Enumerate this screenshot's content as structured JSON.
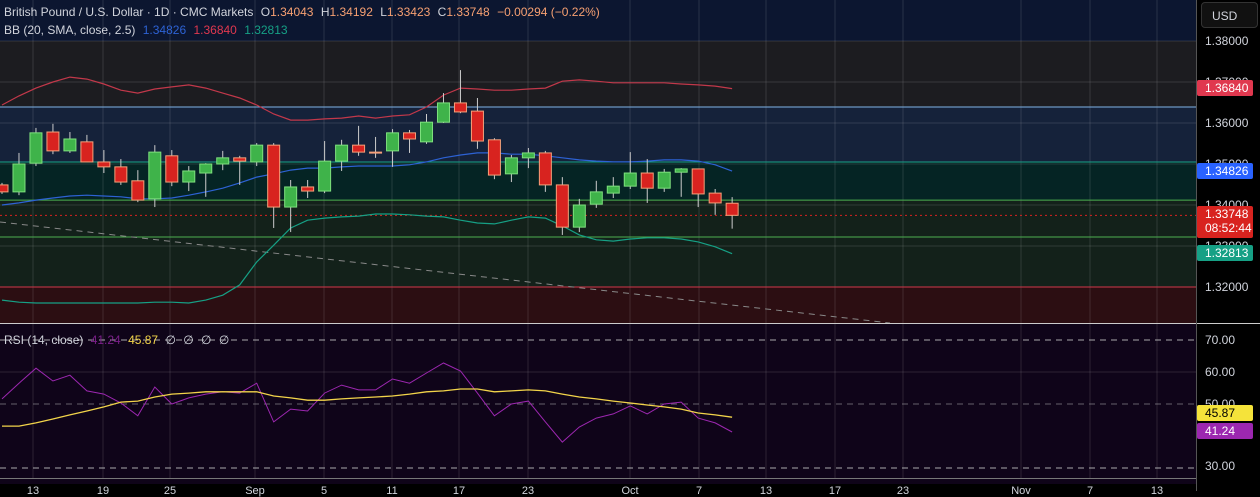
{
  "header": {
    "symbol": "British Pound / U.S. Dollar · 1D · CMC Markets",
    "open_label": "O",
    "open": "1.34043",
    "high_label": "H",
    "high": "1.34192",
    "low_label": "L",
    "low": "1.33423",
    "close_label": "C",
    "close": "1.33748",
    "change": "−0.00294 (−0.22%)"
  },
  "bb_legend": {
    "label": "BB (20, SMA, close, 2.5)",
    "basis": "1.34826",
    "upper": "1.36840",
    "lower": "1.32813"
  },
  "rsi_legend": {
    "label": "RSI (14, close)",
    "rsi": "41.24",
    "ma": "45.87",
    "na1": "∅",
    "na2": "∅",
    "na3": "∅",
    "na4": "∅"
  },
  "axis": {
    "currency": "USD",
    "price_ticks": [
      "1.38000",
      "1.37000",
      "1.36000",
      "1.35000",
      "1.34000",
      "1.33000",
      "1.32000"
    ],
    "rsi_ticks": [
      "70.00",
      "60.00",
      "50.00",
      "30.00"
    ],
    "badges": {
      "upper": "1.36840",
      "basis": "1.34826",
      "price": "1.33748",
      "countdown": "08:52:44",
      "lower": "1.32813",
      "ma": "45.87",
      "rsi": "41.24"
    }
  },
  "x_labels": [
    "13",
    "19",
    "25",
    "Sep",
    "5",
    "11",
    "17",
    "23",
    "Oct",
    "7",
    "13",
    "17",
    "23",
    "Nov",
    "7",
    "13"
  ],
  "colors": {
    "up": "#3fb34a",
    "down": "#d8231f",
    "upper_band": "#c2384a",
    "basis": "#2d62d4",
    "lower_band": "#16a085",
    "rsi": "#9c27b0",
    "rsi_ma": "#f2d44a"
  },
  "chart_data": {
    "type": "candlestick",
    "title": "British Pound / U.S. Dollar · 1D · CMC Markets",
    "ylim": [
      1.313,
      1.38
    ],
    "price_levels": [
      1.3639,
      1.3505,
      1.3412,
      1.3322,
      1.32
    ],
    "candles": [
      [
        1.3449,
        1.3454,
        1.3427,
        1.3432
      ],
      [
        1.3432,
        1.3527,
        1.3424,
        1.35
      ],
      [
        1.3502,
        1.3588,
        1.3495,
        1.3576
      ],
      [
        1.3578,
        1.3598,
        1.3524,
        1.3532
      ],
      [
        1.3532,
        1.3578,
        1.3527,
        1.3561
      ],
      [
        1.3554,
        1.3571,
        1.3505,
        1.3505
      ],
      [
        1.3505,
        1.3534,
        1.3478,
        1.3493
      ],
      [
        1.3493,
        1.3512,
        1.3449,
        1.3456
      ],
      [
        1.3459,
        1.3485,
        1.3407,
        1.3412
      ],
      [
        1.3415,
        1.3546,
        1.3395,
        1.3529
      ],
      [
        1.352,
        1.3534,
        1.3446,
        1.3456
      ],
      [
        1.3456,
        1.3495,
        1.3434,
        1.3483
      ],
      [
        1.3478,
        1.3502,
        1.342,
        1.35
      ],
      [
        1.35,
        1.3532,
        1.3485,
        1.3515
      ],
      [
        1.3515,
        1.352,
        1.3449,
        1.3507
      ],
      [
        1.3505,
        1.3551,
        1.3495,
        1.3546
      ],
      [
        1.3546,
        1.3551,
        1.3344,
        1.3395
      ],
      [
        1.3395,
        1.3461,
        1.3334,
        1.3444
      ],
      [
        1.3444,
        1.3461,
        1.3417,
        1.3434
      ],
      [
        1.3434,
        1.3556,
        1.3429,
        1.3507
      ],
      [
        1.3507,
        1.3559,
        1.3483,
        1.3546
      ],
      [
        1.3546,
        1.3593,
        1.352,
        1.3529
      ],
      [
        1.3529,
        1.3566,
        1.3515,
        1.3528
      ],
      [
        1.3532,
        1.3585,
        1.3493,
        1.3576
      ],
      [
        1.3576,
        1.3583,
        1.3527,
        1.3561
      ],
      [
        1.3554,
        1.3622,
        1.3549,
        1.3602
      ],
      [
        1.3602,
        1.3673,
        1.36,
        1.3649
      ],
      [
        1.3649,
        1.3729,
        1.3624,
        1.3627
      ],
      [
        1.3629,
        1.3661,
        1.3537,
        1.3556
      ],
      [
        1.3559,
        1.3563,
        1.3463,
        1.3473
      ],
      [
        1.3476,
        1.3522,
        1.3456,
        1.3515
      ],
      [
        1.3515,
        1.3539,
        1.349,
        1.3527
      ],
      [
        1.3527,
        1.3532,
        1.3432,
        1.3449
      ],
      [
        1.3449,
        1.3468,
        1.3327,
        1.3346
      ],
      [
        1.3346,
        1.3415,
        1.3334,
        1.34
      ],
      [
        1.3402,
        1.3459,
        1.3393,
        1.3432
      ],
      [
        1.3429,
        1.3468,
        1.3417,
        1.3446
      ],
      [
        1.3446,
        1.3529,
        1.3439,
        1.3478
      ],
      [
        1.3478,
        1.3512,
        1.3405,
        1.3441
      ],
      [
        1.3441,
        1.3488,
        1.3432,
        1.348
      ],
      [
        1.348,
        1.349,
        1.342,
        1.3488
      ],
      [
        1.3488,
        1.3488,
        1.3395,
        1.3427
      ],
      [
        1.3429,
        1.3439,
        1.3376,
        1.3405
      ],
      [
        1.34043,
        1.34192,
        1.33423,
        1.33748
      ]
    ],
    "bb_upper": [
      1.3644,
      1.3666,
      1.3685,
      1.37,
      1.3712,
      1.3707,
      1.3695,
      1.368,
      1.3673,
      1.3683,
      1.3688,
      1.3693,
      1.3685,
      1.3673,
      1.3661,
      1.3644,
      1.3622,
      1.3607,
      1.3607,
      1.361,
      1.3612,
      1.3617,
      1.3612,
      1.3617,
      1.362,
      1.3639,
      1.3668,
      1.3685,
      1.3683,
      1.368,
      1.368,
      1.3683,
      1.3685,
      1.3702,
      1.3705,
      1.3702,
      1.3698,
      1.3698,
      1.3698,
      1.3698,
      1.3695,
      1.3693,
      1.369,
      1.3684
    ],
    "bb_basis": [
      1.34,
      1.3405,
      1.3412,
      1.3417,
      1.3422,
      1.3424,
      1.3422,
      1.342,
      1.3415,
      1.3415,
      1.3417,
      1.3424,
      1.3432,
      1.3441,
      1.3454,
      1.3468,
      1.3476,
      1.3485,
      1.349,
      1.349,
      1.3493,
      1.3495,
      1.3495,
      1.3495,
      1.3498,
      1.3505,
      1.3515,
      1.3522,
      1.3527,
      1.3527,
      1.3524,
      1.3524,
      1.352,
      1.3515,
      1.351,
      1.3507,
      1.3505,
      1.3505,
      1.3507,
      1.351,
      1.351,
      1.3507,
      1.3498,
      1.34826
    ],
    "bb_lower": [
      1.3168,
      1.3163,
      1.3161,
      1.3161,
      1.3161,
      1.3161,
      1.3161,
      1.3161,
      1.3161,
      1.3163,
      1.3163,
      1.3161,
      1.3168,
      1.318,
      1.3205,
      1.3261,
      1.3302,
      1.3344,
      1.3363,
      1.3368,
      1.3371,
      1.3373,
      1.3378,
      1.3378,
      1.3376,
      1.3373,
      1.3371,
      1.3363,
      1.3356,
      1.3354,
      1.3363,
      1.3371,
      1.3368,
      1.3349,
      1.3327,
      1.3315,
      1.3312,
      1.3317,
      1.332,
      1.332,
      1.3317,
      1.331,
      1.3298,
      1.32813
    ],
    "rsi_ylim": [
      25,
      75
    ],
    "rsi_levels": [
      70,
      50,
      30
    ],
    "rsi": [
      51.6,
      56.5,
      61.2,
      57.2,
      59.0,
      54.1,
      53.1,
      50.3,
      46.3,
      55.3,
      50.0,
      51.9,
      53.1,
      53.8,
      53.4,
      56.5,
      44.4,
      48.4,
      47.8,
      53.4,
      55.9,
      54.4,
      54.4,
      57.8,
      56.5,
      59.7,
      62.8,
      60.3,
      53.4,
      46.3,
      50.0,
      50.9,
      44.4,
      38.1,
      42.8,
      45.6,
      46.9,
      49.4,
      46.9,
      50.0,
      50.6,
      45.6,
      44.1,
      41.24
    ],
    "rsi_ma": [
      43.1,
      43.1,
      44.1,
      45.3,
      46.6,
      47.8,
      49.1,
      50.6,
      50.9,
      52.2,
      53.1,
      53.4,
      53.8,
      53.8,
      53.8,
      53.8,
      52.5,
      51.9,
      51.2,
      51.2,
      51.6,
      51.9,
      52.2,
      52.5,
      53.1,
      53.8,
      54.1,
      54.7,
      54.7,
      53.8,
      54.1,
      54.4,
      54.1,
      53.1,
      52.2,
      51.6,
      50.9,
      50.3,
      49.7,
      49.1,
      48.4,
      47.2,
      46.6,
      45.87
    ]
  }
}
